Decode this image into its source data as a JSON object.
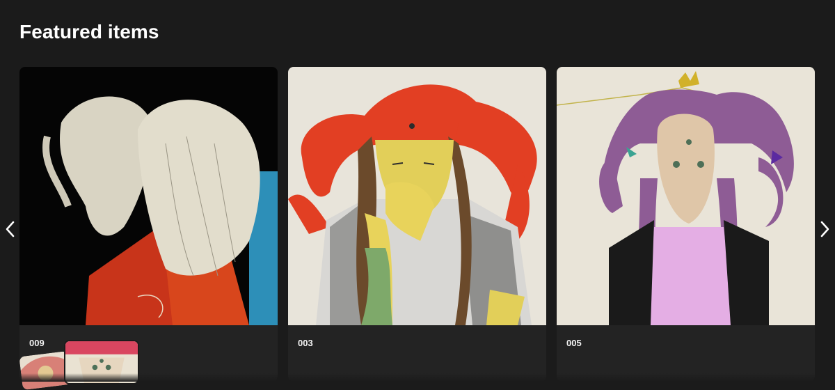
{
  "section": {
    "title": "Featured items"
  },
  "items": [
    {
      "label": "009",
      "art_icon": "portrait-artwork-two-profiles"
    },
    {
      "label": "003",
      "art_icon": "portrait-artwork-man-red-hair"
    },
    {
      "label": "005",
      "art_icon": "portrait-artwork-woman-purple-hair"
    }
  ],
  "nav": {
    "prev_icon": "chevron-left-icon",
    "next_icon": "chevron-right-icon"
  },
  "colors": {
    "background": "#1b1b1b",
    "card": "#232323",
    "text": "#ffffff"
  }
}
